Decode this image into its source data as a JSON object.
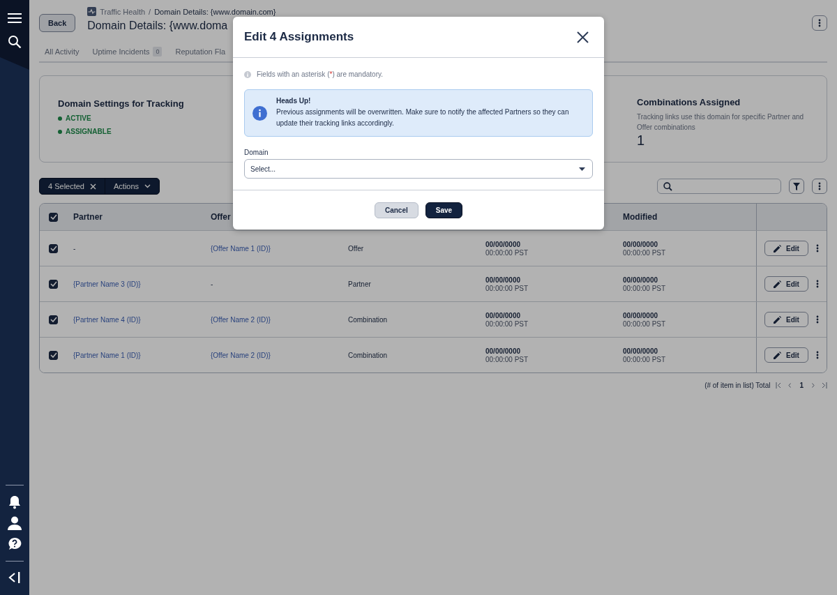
{
  "breadcrumb": {
    "parent": "Traffic Health",
    "separator": "/",
    "current": "Domain Details: {www.domain.com}"
  },
  "back_button": "Back",
  "page_title": "Domain Details: {www.doma",
  "tabs": [
    {
      "label": "All Activity",
      "selected": false
    },
    {
      "label": "Uptime Incidents",
      "badge": "0",
      "selected": false
    },
    {
      "label": "Reputation Fla",
      "selected": false
    }
  ],
  "settings_card": {
    "title": "Domain Settings for Tracking",
    "statuses": [
      {
        "label": "ACTIVE"
      },
      {
        "label": "ASSIGNABLE"
      }
    ]
  },
  "combinations_card": {
    "title": "Combinations Assigned",
    "description": "Tracking links use this domain for specific Partner and Offer combinations",
    "count": "1"
  },
  "toolbar": {
    "selected_count": "4 Selected",
    "actions": "Actions"
  },
  "table": {
    "columns": [
      "Partner",
      "Offer",
      "Modified"
    ],
    "all_checked": true,
    "rows": [
      {
        "checked": true,
        "partner": "-",
        "partner_link": false,
        "offer": "{Offer Name 1 (ID)}",
        "offer_link": true,
        "type": "Offer",
        "created_date": "00/00/0000",
        "created_time": "00:00:00 PST",
        "modified_date": "00/00/0000",
        "modified_time": "00:00:00 PST",
        "action": "Edit"
      },
      {
        "checked": true,
        "partner": "{Partner Name 3 (ID)}",
        "partner_link": true,
        "offer": "-",
        "offer_link": false,
        "type": "Partner",
        "created_date": "00/00/0000",
        "created_time": "00:00:00 PST",
        "modified_date": "00/00/0000",
        "modified_time": "00:00:00 PST",
        "action": "Edit"
      },
      {
        "checked": true,
        "partner": "{Partner Name  4 (ID)}",
        "partner_link": true,
        "offer": "{Offer Name 2 (ID)}",
        "offer_link": true,
        "type": "Combination",
        "created_date": "00/00/0000",
        "created_time": "00:00:00 PST",
        "modified_date": "00/00/0000",
        "modified_time": "00:00:00 PST",
        "action": "Edit"
      },
      {
        "checked": true,
        "partner": "{Partner Name 1 (ID)}",
        "partner_link": true,
        "offer": "{Offer Name 2 (ID)}",
        "offer_link": true,
        "type": "Combination",
        "created_date": "00/00/0000",
        "created_time": "00:00:00 PST",
        "modified_date": "00/00/0000",
        "modified_time": "00:00:00 PST",
        "action": "Edit"
      }
    ]
  },
  "pagination": {
    "total": "(# of item in list) Total",
    "page": "1"
  },
  "modal": {
    "title": "Edit 4 Assignments",
    "note_before": "Fields with an asterisk (",
    "note_mark": "*",
    "note_after": ") are mandatory.",
    "alert": {
      "title": "Heads Up!",
      "message": "Previous assignments will be overwritten. Make sure to notify the affected Partners so they can update their tracking links accordingly."
    },
    "field_label": "Domain",
    "field_placeholder": "Select...",
    "buttons": [
      "Cancel",
      "Save"
    ]
  }
}
